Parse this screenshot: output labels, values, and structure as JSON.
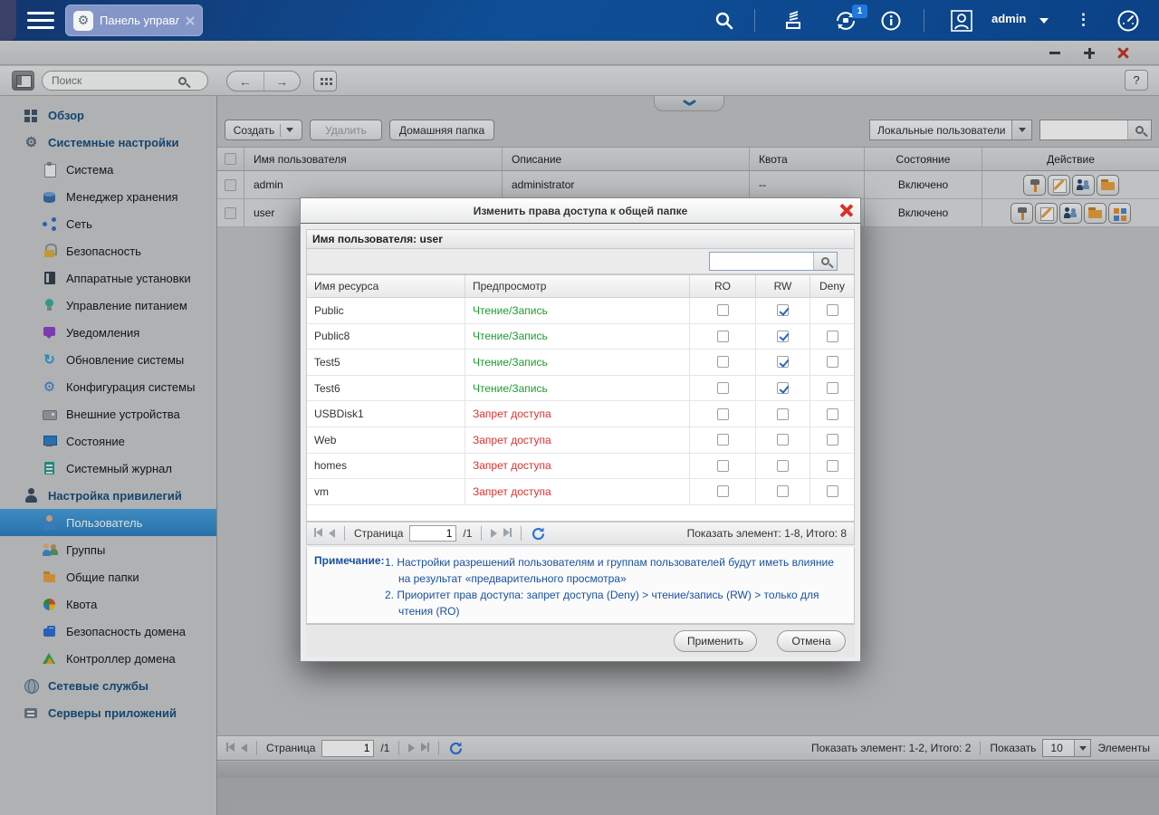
{
  "topbar": {
    "tab_label": "Панель управл...",
    "user": "admin",
    "badge": "1"
  },
  "window": {
    "title": "Панель управления",
    "search_placeholder": "Поиск",
    "help": "?"
  },
  "glyphs": {
    "back": "←",
    "forward": "→",
    "dots": "⋮",
    "gear": "⚙",
    "update": "↻",
    "config": "⚙"
  },
  "sidebar": {
    "items": [
      {
        "label": "Обзор"
      },
      {
        "label": "Системные настройки"
      },
      {
        "label": "Система"
      },
      {
        "label": "Менеджер хранения"
      },
      {
        "label": "Сеть"
      },
      {
        "label": "Безопасность"
      },
      {
        "label": "Аппаратные установки"
      },
      {
        "label": "Управление питанием"
      },
      {
        "label": "Уведомления"
      },
      {
        "label": "Обновление системы"
      },
      {
        "label": "Конфигурация системы"
      },
      {
        "label": "Внешние устройства"
      },
      {
        "label": "Состояние"
      },
      {
        "label": "Системный журнал"
      },
      {
        "label": "Настройка привилегий"
      },
      {
        "label": "Пользователь"
      },
      {
        "label": "Группы"
      },
      {
        "label": "Общие папки"
      },
      {
        "label": "Квота"
      },
      {
        "label": "Безопасность домена"
      },
      {
        "label": "Контроллер домена"
      },
      {
        "label": "Сетевые службы"
      },
      {
        "label": "Серверы приложений"
      }
    ]
  },
  "main": {
    "toolbar": {
      "create": "Создать",
      "delete": "Удалить",
      "home_folder": "Домашняя папка",
      "filter_value": "Локальные пользователи"
    },
    "table": {
      "headers": [
        "Имя пользователя",
        "Описание",
        "Квота",
        "Состояние",
        "Действие"
      ],
      "rows": [
        {
          "name": "admin",
          "description": "administrator",
          "quota": "--",
          "status": "Включено"
        },
        {
          "name": "user",
          "description": "",
          "quota": "",
          "status": "Включено"
        }
      ]
    },
    "pagination": {
      "page_label": "Страница",
      "page": "1",
      "of": "/1",
      "summary": "Показать элемент: 1-2, Итого: 2",
      "show_label": "Показать",
      "page_size": "10",
      "items_label": "Элементы"
    }
  },
  "dialog": {
    "title": "Изменить права доступа к общей папке",
    "subtitle": "Имя пользователя: user",
    "table": {
      "headers": [
        "Имя ресурса",
        "Предпросмотр",
        "RO",
        "RW",
        "Deny"
      ],
      "rows": [
        {
          "name": "Public",
          "preview": "Чтение/Запись",
          "state": "allow",
          "ro": false,
          "rw": true,
          "deny": false
        },
        {
          "name": "Public8",
          "preview": "Чтение/Запись",
          "state": "allow",
          "ro": false,
          "rw": true,
          "deny": false
        },
        {
          "name": "Test5",
          "preview": "Чтение/Запись",
          "state": "allow",
          "ro": false,
          "rw": true,
          "deny": false
        },
        {
          "name": "Test6",
          "preview": "Чтение/Запись",
          "state": "allow",
          "ro": false,
          "rw": true,
          "deny": false
        },
        {
          "name": "USBDisk1",
          "preview": "Запрет доступа",
          "state": "deny",
          "ro": false,
          "rw": false,
          "deny": false
        },
        {
          "name": "Web",
          "preview": "Запрет доступа",
          "state": "deny",
          "ro": false,
          "rw": false,
          "deny": false
        },
        {
          "name": "homes",
          "preview": "Запрет доступа",
          "state": "deny",
          "ro": false,
          "rw": false,
          "deny": false
        },
        {
          "name": "vm",
          "preview": "Запрет доступа",
          "state": "deny",
          "ro": false,
          "rw": false,
          "deny": false
        }
      ]
    },
    "pagination": {
      "page_label": "Страница",
      "page": "1",
      "of": "/1",
      "summary": "Показать элемент: 1-8, Итого: 8"
    },
    "note_label": "Примечание:",
    "notes": [
      "1. Настройки разрешений пользователям и группам пользователей будут иметь влияние на результат «предварительного просмотра»",
      "2. Приоритет прав доступа: запрет доступа (Deny) > чтение/запись (RW) > только для чтения (RO)"
    ],
    "apply_label": "Применить",
    "cancel_label": "Отмена"
  },
  "colors": {
    "accent_blue": "#2e83c4",
    "allow_green": "#1e9c30",
    "deny_red": "#e03131",
    "badge_blue": "#1f7ae0",
    "close_red": "#d93025"
  }
}
